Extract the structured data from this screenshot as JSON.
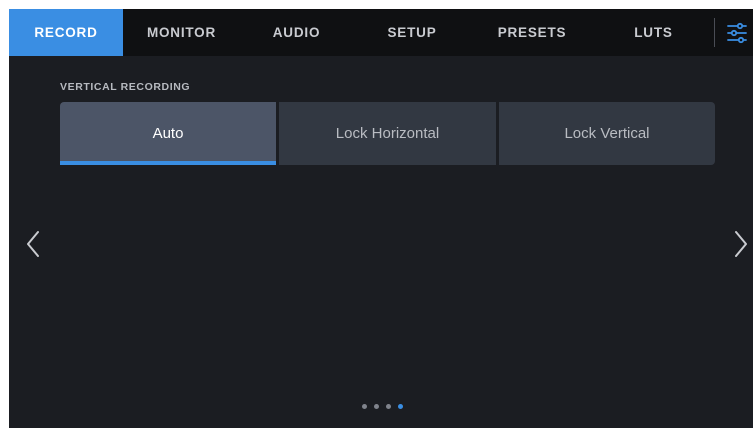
{
  "tabs": [
    {
      "label": "RECORD",
      "active": true
    },
    {
      "label": "MONITOR",
      "active": false
    },
    {
      "label": "AUDIO",
      "active": false
    },
    {
      "label": "SETUP",
      "active": false
    },
    {
      "label": "PRESETS",
      "active": false
    },
    {
      "label": "LUTS",
      "active": false
    }
  ],
  "settings_icon": "sliders-icon",
  "section": {
    "title": "VERTICAL RECORDING",
    "options": [
      {
        "label": "Auto",
        "selected": true
      },
      {
        "label": "Lock Horizontal",
        "selected": false
      },
      {
        "label": "Lock Vertical",
        "selected": false
      }
    ]
  },
  "navigation": {
    "prev_icon": "chevron-left-icon",
    "next_icon": "chevron-right-icon"
  },
  "pagination": {
    "total": 4,
    "current": 4
  },
  "colors": {
    "accent": "#3a8ee3",
    "background": "#1b1d22",
    "tab_bar": "#0f1012",
    "button": "#323842",
    "button_selected": "#4c5567"
  }
}
